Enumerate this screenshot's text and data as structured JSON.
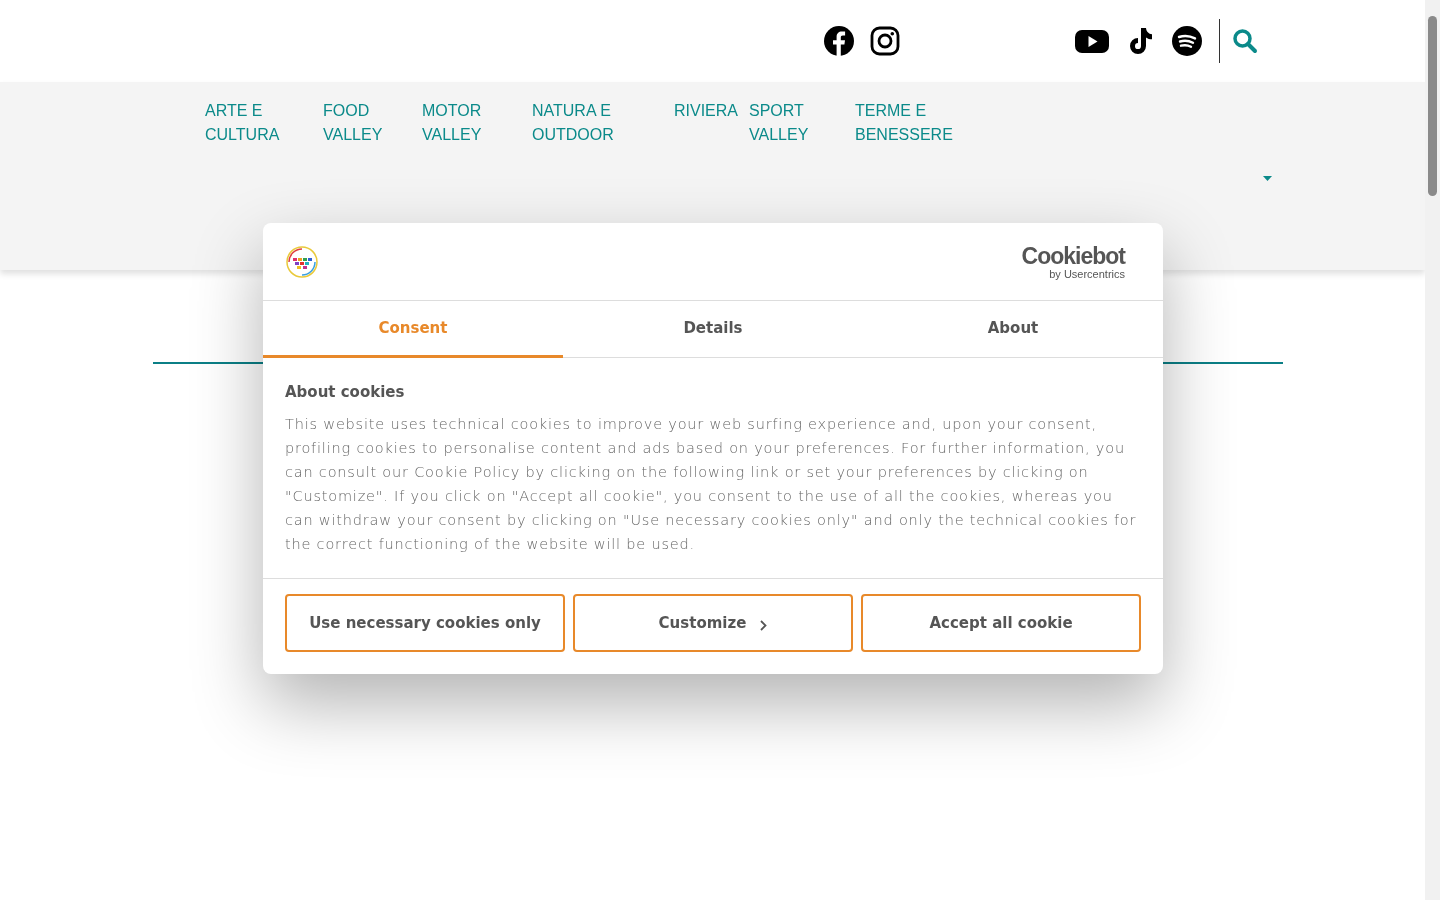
{
  "header": {
    "social_left": [
      {
        "kind": "facebook"
      },
      {
        "kind": "instagram"
      }
    ],
    "social_right": [
      {
        "kind": "youtube"
      },
      {
        "kind": "tiktok"
      },
      {
        "kind": "spotify"
      }
    ]
  },
  "nav": {
    "items": [
      {
        "label": "ARTE E CULTURA"
      },
      {
        "label": "FOOD VALLEY"
      },
      {
        "label": "MOTOR VALLEY"
      },
      {
        "label": "NATURA E OUTDOOR"
      },
      {
        "label": "RIVIERA"
      },
      {
        "label": "SPORT VALLEY"
      },
      {
        "label": "TERME E BENESSERE"
      }
    ]
  },
  "dialog": {
    "brand": "Cookiebot",
    "brand_sub": "by Usercentrics",
    "tabs": [
      {
        "label": "Consent",
        "selected": true
      },
      {
        "label": "Details",
        "selected": false
      },
      {
        "label": "About",
        "selected": false
      }
    ],
    "heading": "About cookies",
    "body": "This website uses technical cookies to improve your web surfing experience and, upon your consent, profiling cookies to personalise content and ads based on your preferences. For further information, you can consult our Cookie Policy by clicking on the following link or set your preferences by clicking on \"Customize\". If you click on \"Accept all cookie\", you consent to the use of all the cookies, whereas you can withdraw your consent by clicking on \"Use necessary cookies only\" and only the technical cookies for the correct functioning of the website will be used.",
    "buttons": [
      {
        "label": "Use necessary cookies only",
        "chevron": false
      },
      {
        "label": "Customize",
        "chevron": true
      },
      {
        "label": "Accept all cookie",
        "chevron": false
      }
    ]
  }
}
